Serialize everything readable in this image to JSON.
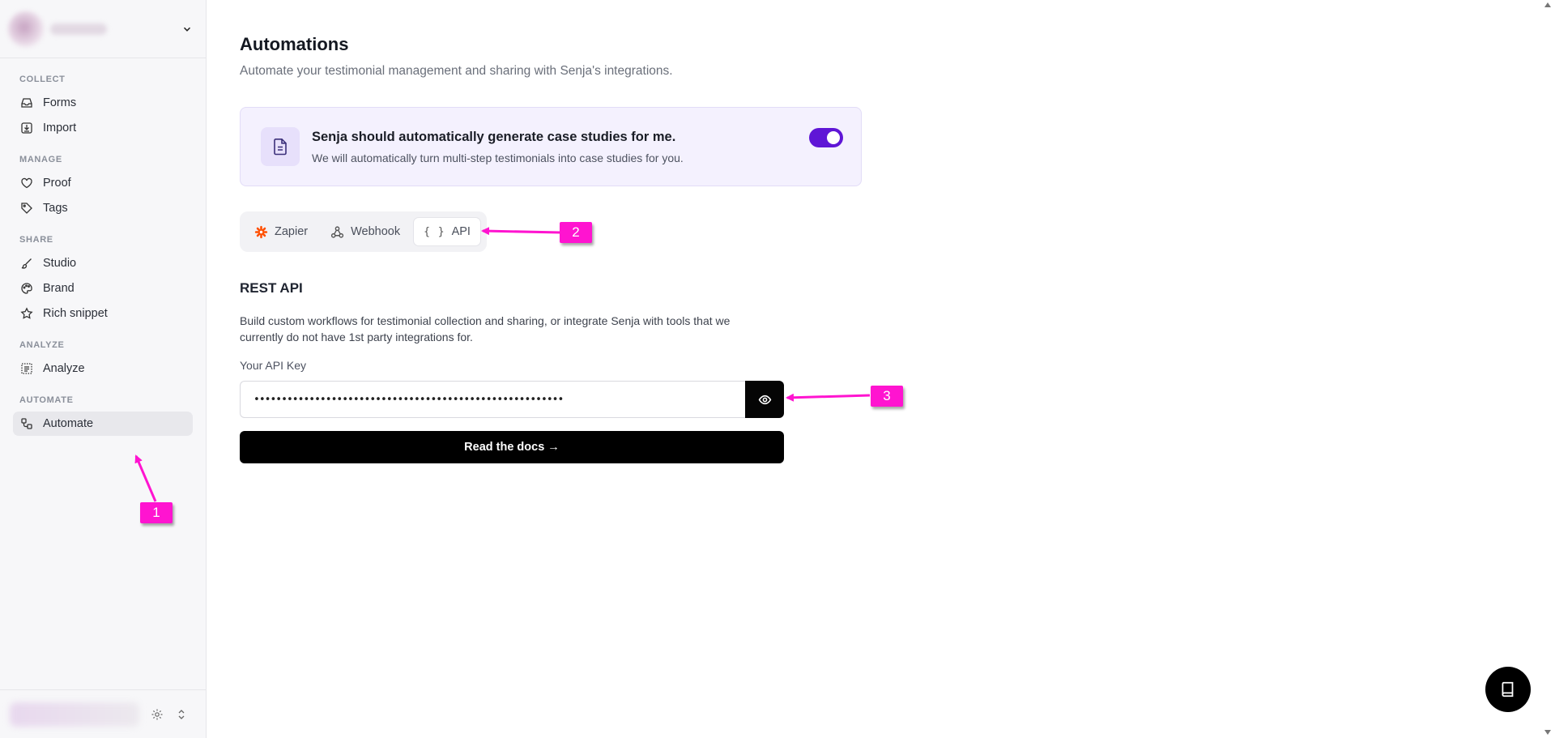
{
  "sidebar": {
    "sections": [
      {
        "label": "COLLECT",
        "items": [
          {
            "label": "Forms",
            "icon": "inbox-icon"
          },
          {
            "label": "Import",
            "icon": "import-icon"
          }
        ]
      },
      {
        "label": "MANAGE",
        "items": [
          {
            "label": "Proof",
            "icon": "heart-icon"
          },
          {
            "label": "Tags",
            "icon": "tag-icon"
          }
        ]
      },
      {
        "label": "SHARE",
        "items": [
          {
            "label": "Studio",
            "icon": "brush-icon"
          },
          {
            "label": "Brand",
            "icon": "palette-icon"
          },
          {
            "label": "Rich snippet",
            "icon": "star-icon"
          }
        ]
      },
      {
        "label": "ANALYZE",
        "items": [
          {
            "label": "Analyze",
            "icon": "grid-icon"
          }
        ]
      },
      {
        "label": "AUTOMATE",
        "items": [
          {
            "label": "Automate",
            "icon": "workflow-icon",
            "active": true
          }
        ]
      }
    ]
  },
  "header": {
    "title": "Automations",
    "subtitle": "Automate your testimonial management and sharing with Senja's integrations."
  },
  "case_study": {
    "title": "Senja should automatically generate case studies for me.",
    "description": "We will automatically turn multi-step testimonials into case studies for you.",
    "enabled": true,
    "toggle_color": "#5f16d6"
  },
  "tabs": [
    {
      "label": "Zapier",
      "icon": "zapier-icon"
    },
    {
      "label": "Webhook",
      "icon": "webhook-icon"
    },
    {
      "label": "API",
      "icon": "braces-icon",
      "active": true
    }
  ],
  "api": {
    "section_title": "REST API",
    "description": "Build custom workflows for testimonial collection and sharing, or integrate Senja with tools that we currently do not have 1st party integrations for.",
    "key_label": "Your API Key",
    "key_value": "••••••••••••••••••••••••••••••••••••••••••••••••••••••••",
    "docs_button": "Read the docs →"
  },
  "annotations": [
    "1",
    "2",
    "3"
  ],
  "colors": {
    "annotation": "#ff14d0",
    "accent": "#5f16d6"
  }
}
